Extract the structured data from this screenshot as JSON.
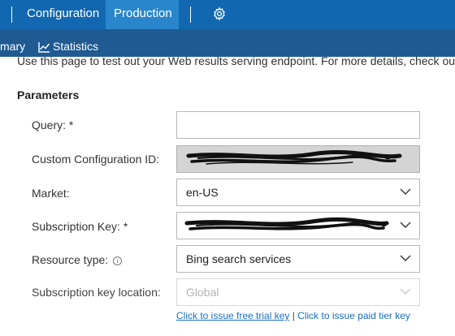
{
  "nav": {
    "tabs": [
      {
        "label": "Configuration"
      },
      {
        "label": "Production",
        "active": true
      }
    ],
    "settings_icon": "gear-icon"
  },
  "subnav": {
    "items": [
      {
        "label": "mary"
      },
      {
        "label": "Statistics",
        "icon": "chart-line-icon"
      }
    ]
  },
  "intro_text": "Use this page to test out your Web results serving endpoint. For more details, check out",
  "parameters": {
    "title": "Parameters",
    "fields": [
      {
        "label": "Query: *",
        "value": ""
      },
      {
        "label": "Custom Configuration ID:",
        "value_redacted": true
      },
      {
        "label": "Market:",
        "value": "en-US"
      },
      {
        "label": "Subscription Key: *",
        "value_redacted": true
      },
      {
        "label": "Resource type:",
        "info_icon": "info-icon",
        "value": "Bing search services"
      },
      {
        "label": "Subscription key location:",
        "value": "Global",
        "disabled": true
      }
    ]
  },
  "links": {
    "free_trial": "Click to issue free trial key",
    "separator": " | ",
    "paid_tier": "Click to issue paid tier key"
  },
  "colors": {
    "topbar": "#1168b0",
    "topbar_active_tab": "#2a86cc",
    "subbar": "#1f5a92",
    "link": "#1a6fc0",
    "readonly_field": "#d4d4d4"
  }
}
